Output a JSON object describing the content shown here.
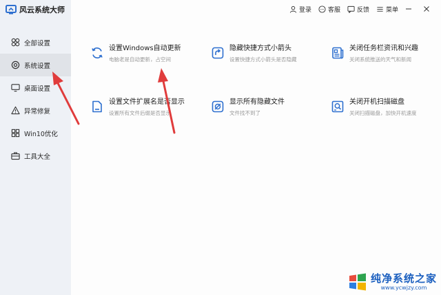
{
  "app": {
    "title": "风云系统大师"
  },
  "topbar": {
    "login": "登录",
    "support": "客服",
    "feedback": "反馈",
    "menu": "菜单"
  },
  "sidebar": {
    "items": [
      {
        "label": "全部设置",
        "icon": "grid-icon"
      },
      {
        "label": "系统设置",
        "icon": "settings-icon",
        "active": true
      },
      {
        "label": "桌面设置",
        "icon": "monitor-icon"
      },
      {
        "label": "异常修复",
        "icon": "warning-icon"
      },
      {
        "label": "Win10优化",
        "icon": "windows-icon"
      },
      {
        "label": "工具大全",
        "icon": "toolbox-icon"
      }
    ]
  },
  "cards": [
    {
      "title": "设置Windows自动更新",
      "desc": "电脑老是自动更新，占空间",
      "icon": "refresh-icon"
    },
    {
      "title": "隐藏快捷方式小箭头",
      "desc": "设置快捷方式小箭头是否隐藏",
      "icon": "shortcut-arrow-icon"
    },
    {
      "title": "关闭任务栏资讯和兴趣",
      "desc": "关闭系统推送的天气和新闻",
      "icon": "news-icon"
    },
    {
      "title": "设置文件扩展名是否显示",
      "desc": "设置所有文件后缀是否显示",
      "icon": "file-icon"
    },
    {
      "title": "显示所有隐藏文件",
      "desc": "文件找不到了",
      "icon": "hidden-file-icon"
    },
    {
      "title": "关闭开机扫描磁盘",
      "desc": "关闭扫描磁盘，加快开机速度",
      "icon": "disk-scan-icon"
    }
  ],
  "watermark": {
    "main": "纯净系统之家",
    "sub": "www.ycwjzy.com"
  },
  "colors": {
    "accent": "#2d6fcf",
    "sidebar_bg": "#eef1f6",
    "active_bg": "#e0e3e8",
    "arrow": "#e03c3c",
    "watermark": "#1b5fbf"
  }
}
